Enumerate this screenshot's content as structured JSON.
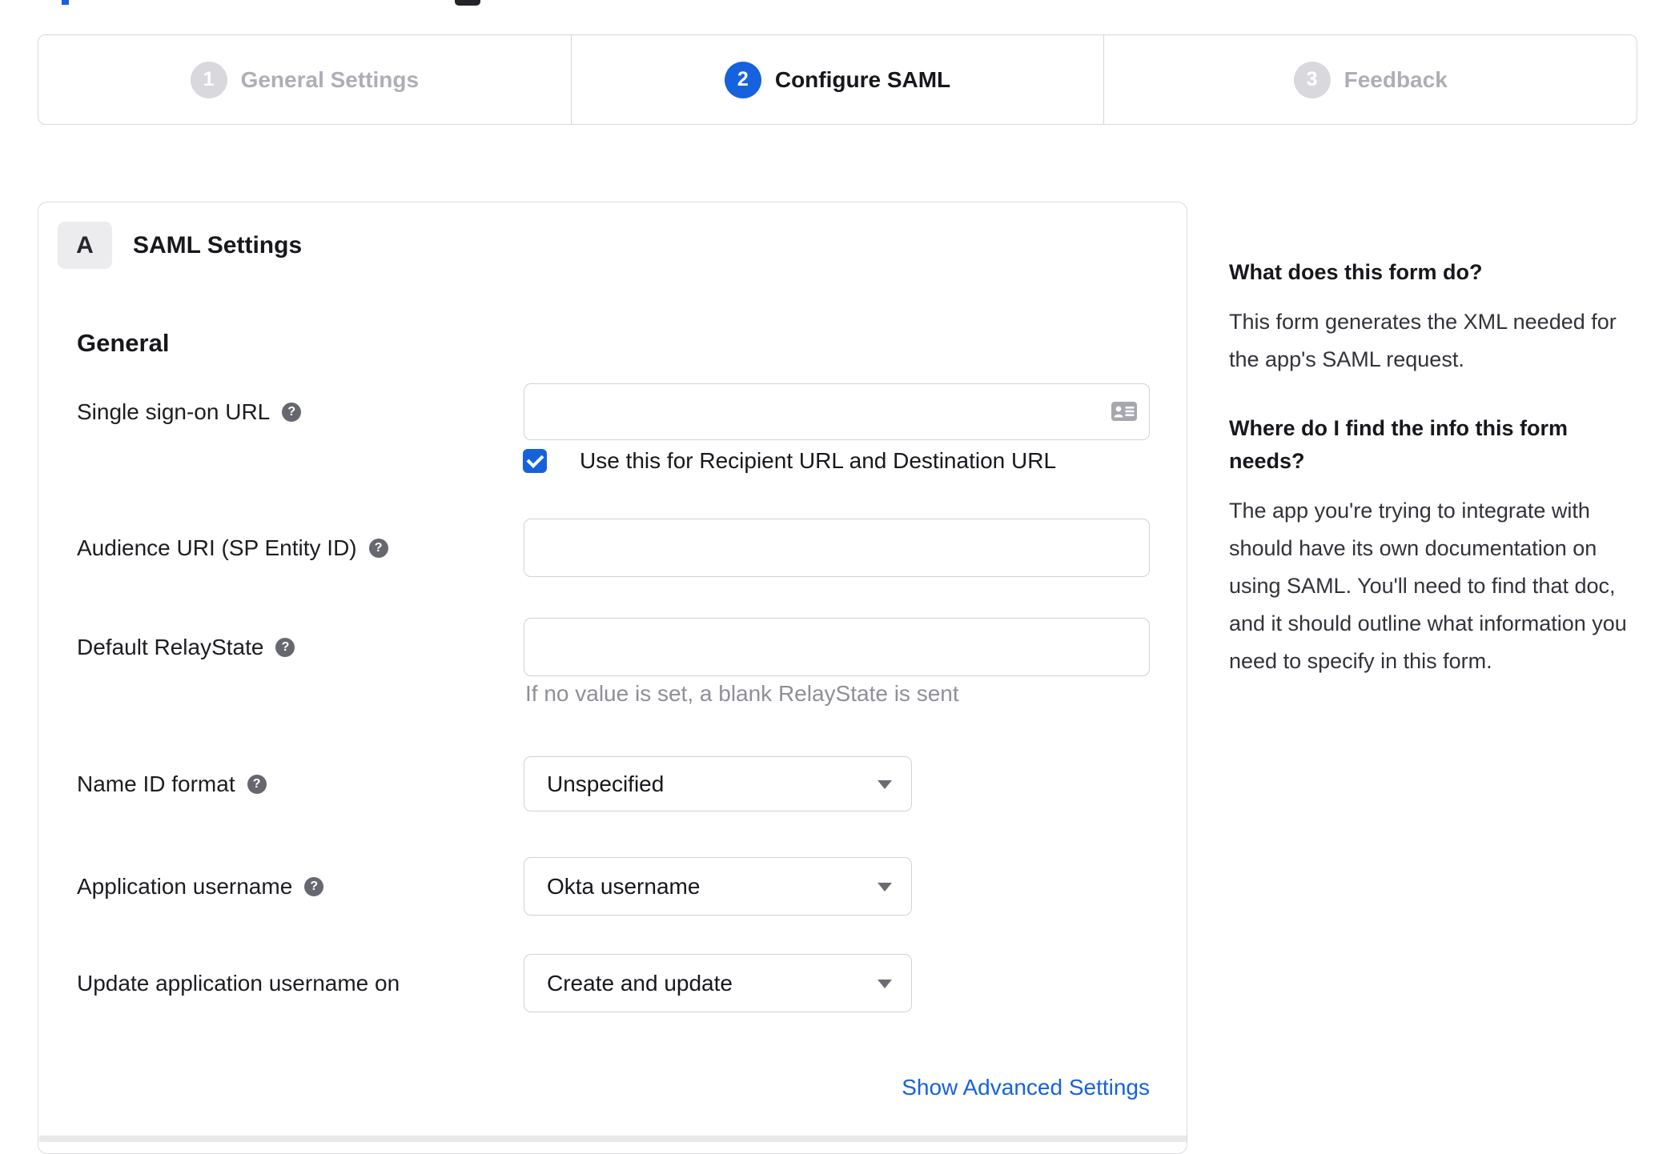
{
  "stepper": {
    "steps": [
      {
        "number": "1",
        "label": "General Settings",
        "state": "inactive"
      },
      {
        "number": "2",
        "label": "Configure SAML",
        "state": "active"
      },
      {
        "number": "3",
        "label": "Feedback",
        "state": "inactive"
      }
    ]
  },
  "panel": {
    "section_badge": "A",
    "section_title": "SAML Settings",
    "heading": "General",
    "fields": {
      "sso": {
        "label": "Single sign-on URL",
        "value": "",
        "checkbox_label": "Use this for Recipient URL and Destination URL",
        "checkbox_checked": true
      },
      "audience": {
        "label": "Audience URI (SP Entity ID)",
        "value": ""
      },
      "relay": {
        "label": "Default RelayState",
        "value": "",
        "hint": "If no value is set, a blank RelayState is sent"
      },
      "nameid": {
        "label": "Name ID format",
        "value": "Unspecified"
      },
      "appuser": {
        "label": "Application username",
        "value": "Okta username"
      },
      "update": {
        "label": "Update application username on",
        "value": "Create and update"
      }
    },
    "advanced_link": "Show Advanced Settings"
  },
  "sidebar": {
    "blocks": [
      {
        "title": "What does this form do?",
        "body": "This form generates the XML needed for the app's SAML request."
      },
      {
        "title": "Where do I find the info this form needs?",
        "body": "The app you're trying to integrate with should have its own documentation on using SAML. You'll need to find that doc, and it should outline what information you need to specify in this form."
      }
    ]
  },
  "icons": {
    "help_glyph": "?"
  },
  "colors": {
    "accent_blue": "#1662dd",
    "inactive_step_gray": "#d9d9dd",
    "input_border": "#d2d2d8",
    "hint_gray": "#8f8f98"
  }
}
